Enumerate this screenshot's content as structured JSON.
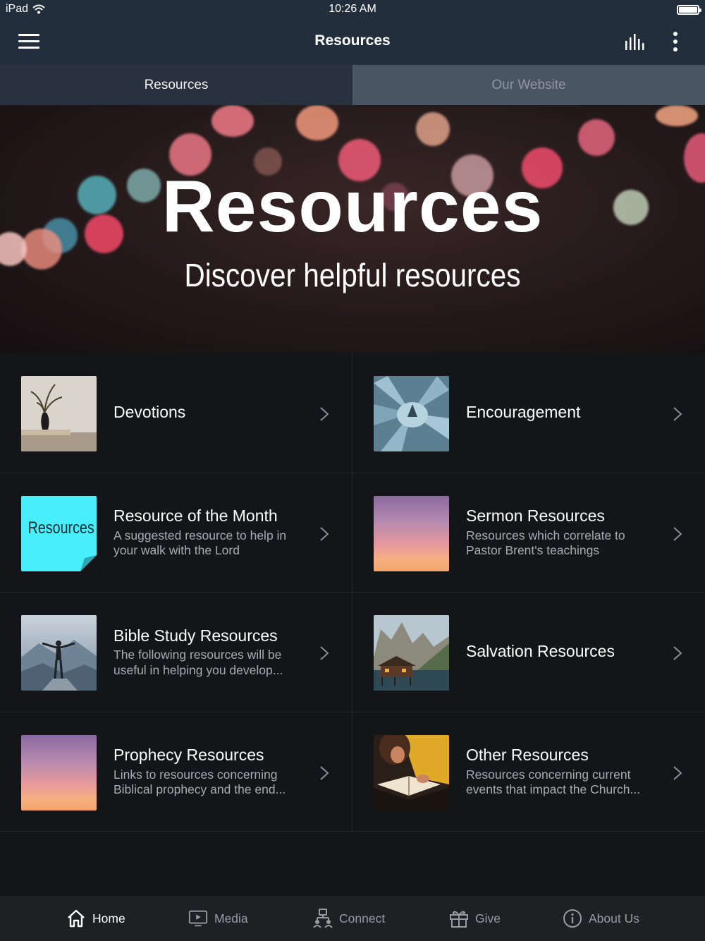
{
  "status_bar": {
    "device": "iPad",
    "time": "10:26 AM"
  },
  "nav": {
    "title": "Resources"
  },
  "tabs": [
    {
      "label": "Resources",
      "active": true
    },
    {
      "label": "Our Website",
      "active": false
    }
  ],
  "hero": {
    "title": "Resources",
    "subtitle": "Discover helpful resources"
  },
  "thumb_text": {
    "resource_of_month": "Resources"
  },
  "items": [
    {
      "title": "Devotions",
      "description": ""
    },
    {
      "title": "Encouragement",
      "description": ""
    },
    {
      "title": "Resource of the Month",
      "description": "A suggested resource to help in your walk with the Lord"
    },
    {
      "title": "Sermon Resources",
      "description": "Resources which correlate to Pastor Brent's teachings"
    },
    {
      "title": "Bible Study Resources",
      "description": "The following resources will be useful in helping you develop..."
    },
    {
      "title": "Salvation Resources",
      "description": ""
    },
    {
      "title": "Prophecy Resources",
      "description": "Links to resources concerning Biblical prophecy and the end..."
    },
    {
      "title": "Other Resources",
      "description": "Resources concerning current events that impact the Church..."
    }
  ],
  "tabbar": {
    "home": "Home",
    "media": "Media",
    "connect": "Connect",
    "give": "Give",
    "about": "About Us"
  },
  "colors": {
    "header_bg": "#222e3c",
    "tab_active_bg": "#28313d",
    "tab_inactive_bg": "#4a5563",
    "page_bg": "#141519",
    "tabbar_bg": "#1f2024",
    "accent_cyan": "#49eefc"
  }
}
